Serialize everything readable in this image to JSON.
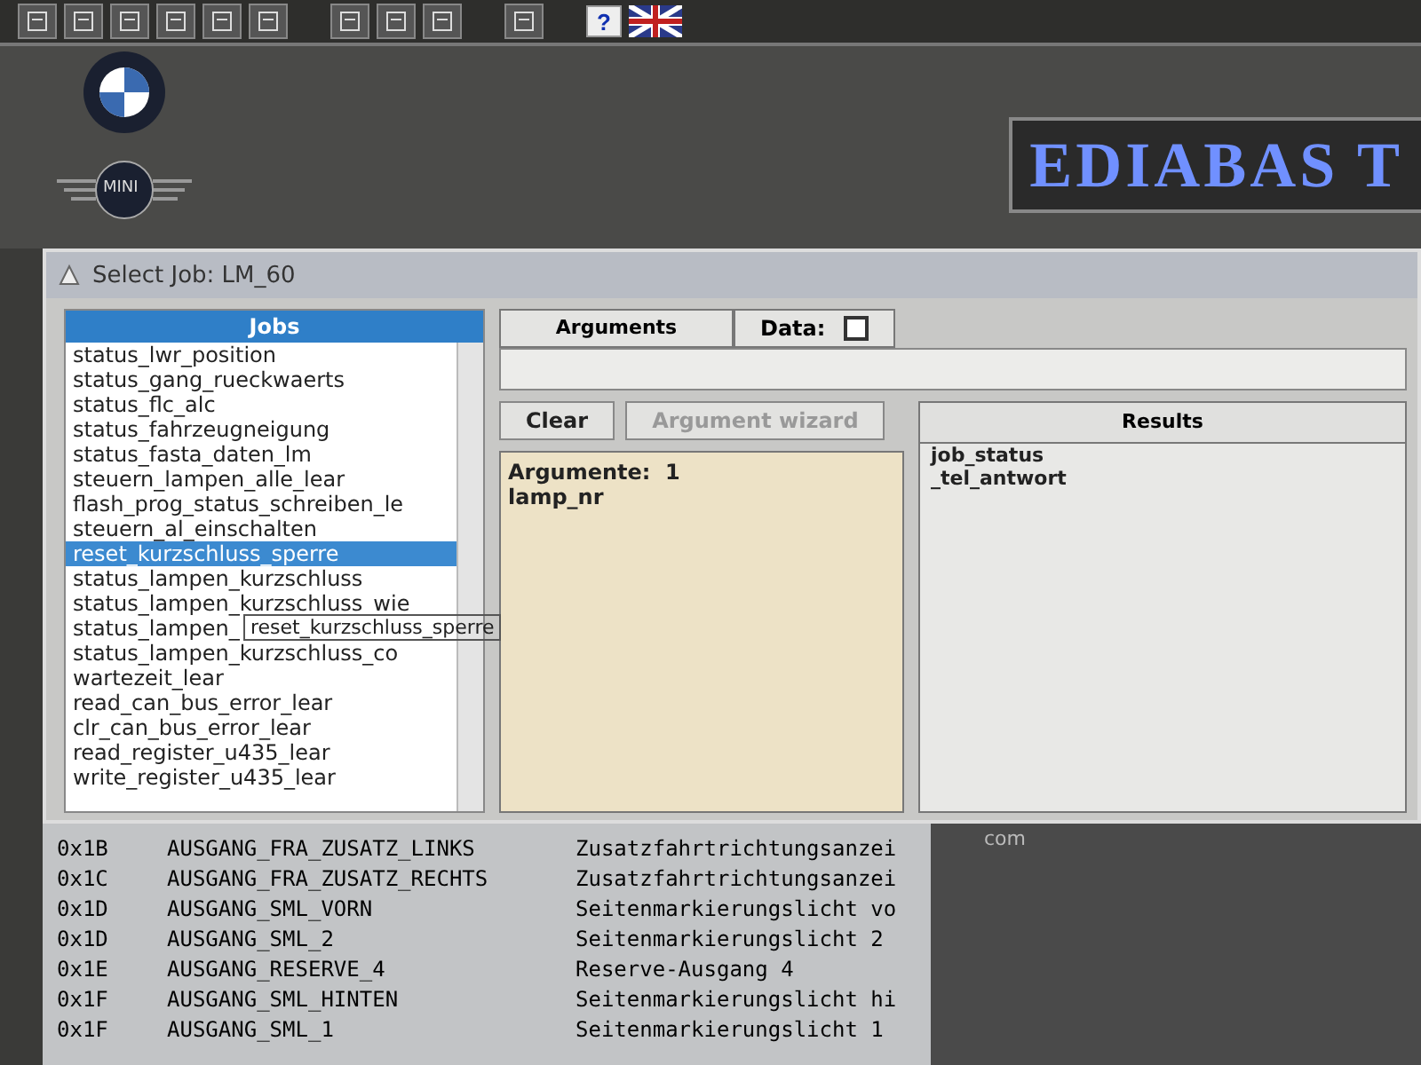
{
  "toolbar": {
    "help_label": "?"
  },
  "header": {
    "banner": "EDIABAS T",
    "mini_label": "MINI"
  },
  "dialog": {
    "title": "Select Job: LM_60",
    "jobs": {
      "heading": "Jobs",
      "items": [
        {
          "label": "status_lwr_position",
          "selected": false
        },
        {
          "label": "status_gang_rueckwaerts",
          "selected": false
        },
        {
          "label": "status_flc_alc",
          "selected": false
        },
        {
          "label": "status_fahrzeugneigung",
          "selected": false
        },
        {
          "label": "status_fasta_daten_lm",
          "selected": false
        },
        {
          "label": "steuern_lampen_alle_lear",
          "selected": false
        },
        {
          "label": "flash_prog_status_schreiben_le",
          "selected": false
        },
        {
          "label": "steuern_al_einschalten",
          "selected": false
        },
        {
          "label": "reset_kurzschluss_sperre",
          "selected": true
        },
        {
          "label": "status_lampen_kurzschluss",
          "selected": false
        },
        {
          "label": "status_lampen_kurzschluss_wie",
          "selected": false
        },
        {
          "label": "status_lampen_",
          "selected": false
        },
        {
          "label": "status_lampen_kurzschluss_co",
          "selected": false
        },
        {
          "label": "wartezeit_lear",
          "selected": false
        },
        {
          "label": "read_can_bus_error_lear",
          "selected": false
        },
        {
          "label": "clr_can_bus_error_lear",
          "selected": false
        },
        {
          "label": "read_register_u435_lear",
          "selected": false
        },
        {
          "label": "write_register_u435_lear",
          "selected": false
        }
      ],
      "tooltip": "reset_kurzschluss_sperre"
    },
    "arguments_tab": "Arguments",
    "data": {
      "label": "Data:",
      "checked": false
    },
    "buttons": [
      {
        "label": "Clear",
        "disabled": false
      },
      {
        "label": "Argument wizard",
        "disabled": true
      }
    ],
    "arguments_text": [
      "Argumente:  1",
      "lamp_nr"
    ],
    "results": {
      "heading": "Results",
      "items": [
        "job_status",
        "_tel_antwort"
      ]
    }
  },
  "table": {
    "rows": [
      {
        "code": "0x1B",
        "name": "AUSGANG_FRA_ZUSATZ_LINKS",
        "description": "Zusatzfahrtrichtungsanzei"
      },
      {
        "code": "0x1C",
        "name": "AUSGANG_FRA_ZUSATZ_RECHTS",
        "description": "Zusatzfahrtrichtungsanzei"
      },
      {
        "code": "0x1D",
        "name": "AUSGANG_SML_VORN",
        "description": "Seitenmarkierungslicht vo"
      },
      {
        "code": "0x1D",
        "name": "AUSGANG_SML_2",
        "description": "Seitenmarkierungslicht 2"
      },
      {
        "code": "0x1E",
        "name": "AUSGANG_RESERVE_4",
        "description": "Reserve-Ausgang 4"
      },
      {
        "code": "0x1F",
        "name": "AUSGANG_SML_HINTEN",
        "description": "Seitenmarkierungslicht hi"
      },
      {
        "code": "0x1F",
        "name": "AUSGANG_SML_1",
        "description": "Seitenmarkierungslicht 1"
      }
    ],
    "side_text": "com"
  }
}
